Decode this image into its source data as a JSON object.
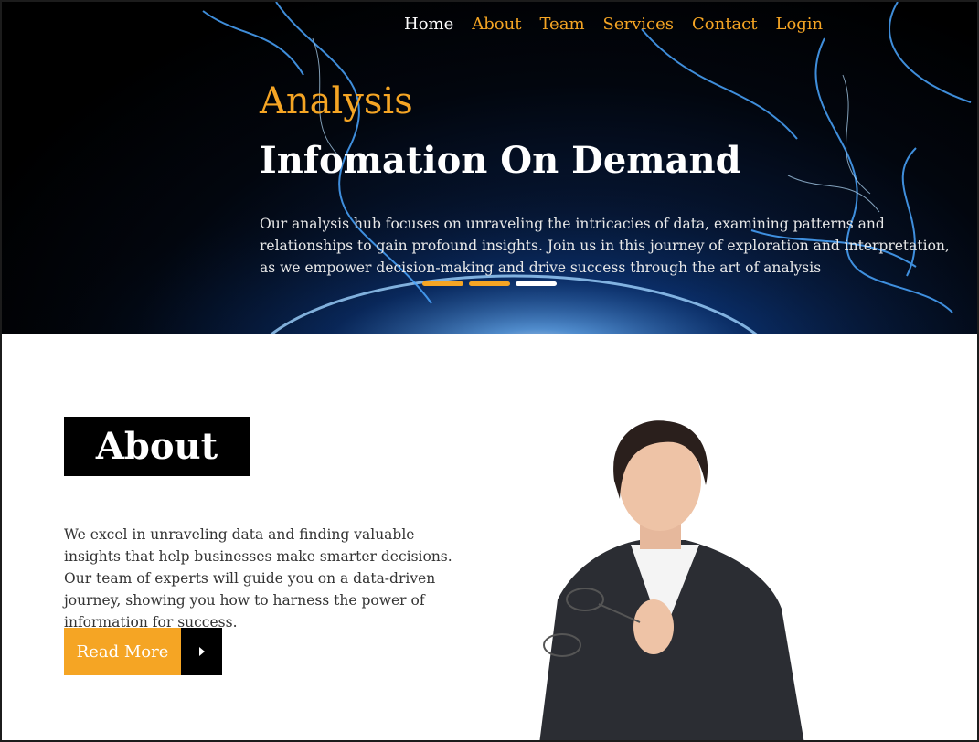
{
  "nav": {
    "items": [
      {
        "label": "Home",
        "active": true
      },
      {
        "label": "About",
        "active": false
      },
      {
        "label": "Team",
        "active": false
      },
      {
        "label": "Services",
        "active": false
      },
      {
        "label": "Contact",
        "active": false
      },
      {
        "label": "Login",
        "active": false
      }
    ]
  },
  "hero": {
    "subtitle": "Analysis",
    "title": "Infomation On Demand",
    "text": "Our analysis hub focuses on unraveling the intricacies of data, examining patterns and relationships to gain profound insights. Join us in this journey of exploration and interpretation, as we empower decision-making and drive success through the art of analysis",
    "slider": {
      "count": 3,
      "active_index": 2
    }
  },
  "about": {
    "heading": "About",
    "text": "We excel in unraveling data and finding valuable insights that help businesses make smarter decisions. Our team of experts will guide you on a data-driven journey, showing you how to harness the power of information for success.",
    "button_label": "Read More"
  },
  "colors": {
    "accent": "#f5a524",
    "dark": "#000000",
    "white": "#ffffff"
  }
}
